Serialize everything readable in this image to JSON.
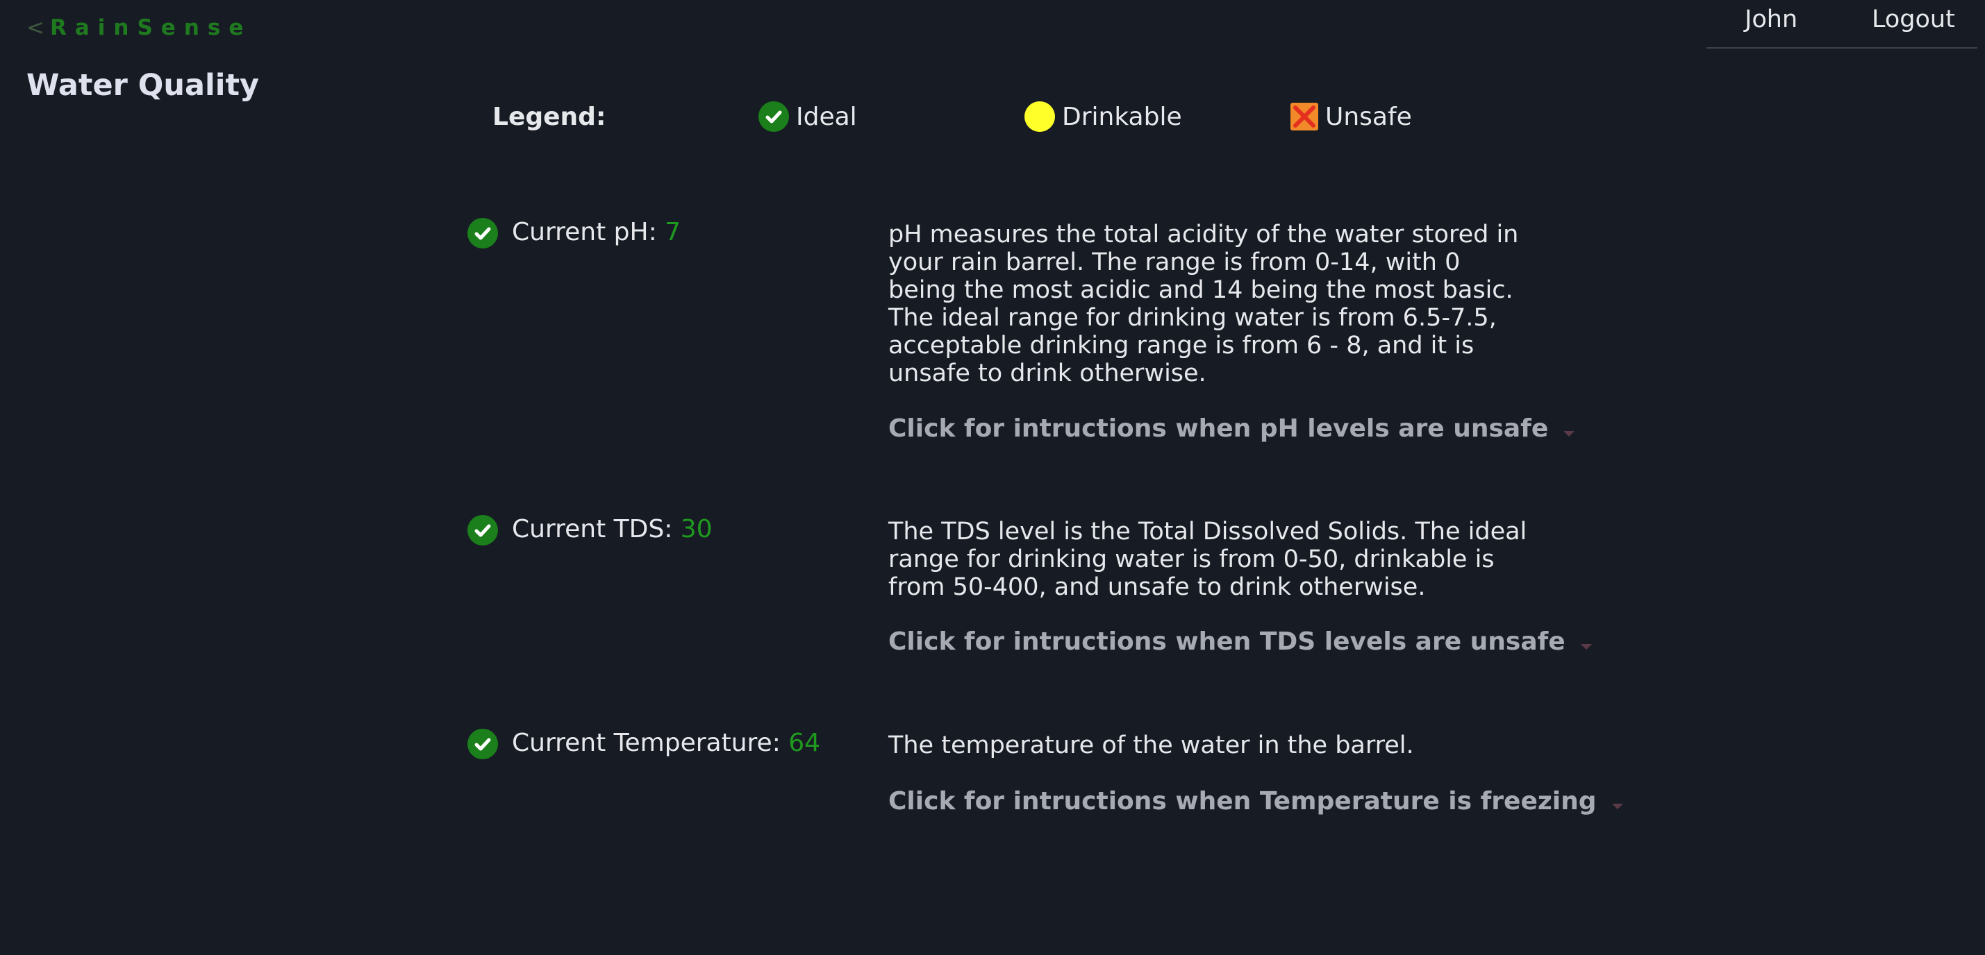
{
  "brand": {
    "caret": "<",
    "name": "RainSense"
  },
  "page_title": "Water Quality",
  "nav": {
    "user": "John",
    "logout": "Logout"
  },
  "legend": {
    "label": "Legend:",
    "items": [
      {
        "label": "Ideal",
        "icon": "green-check-icon",
        "color": "#1b7f1b"
      },
      {
        "label": "Drinkable",
        "icon": "yellow-circle-icon",
        "color": "#ffff29"
      },
      {
        "label": "Unsafe",
        "icon": "red-x-icon",
        "color": "#f28a2a"
      }
    ]
  },
  "metrics": [
    {
      "label": "Current pH: ",
      "value": "7",
      "status": "ideal",
      "description": "pH measures the total acidity of the water stored in your rain barrel. The range is from 0-14, with 0 being the most acidic and 14 being the most basic. The ideal range for drinking water is from 6.5-7.5, acceptable drinking range is from 6 - 8, and it is unsafe to drink otherwise.",
      "instructions_toggle": "Click for intructions when pH levels are unsafe"
    },
    {
      "label": "Current TDS: ",
      "value": "30",
      "status": "ideal",
      "description": "The TDS level is the Total Dissolved Solids. The ideal range for drinking water is from 0-50, drinkable is from 50-400, and unsafe to drink otherwise.",
      "instructions_toggle": "Click for intructions when TDS levels are unsafe"
    },
    {
      "label": "Current Temperature: ",
      "value": "64",
      "status": "ideal",
      "description": "The temperature of the water in the barrel.",
      "instructions_toggle": "Click for intructions when Temperature is freezing"
    }
  ],
  "colors": {
    "background": "#171c24",
    "accent_green": "#1f9a1f",
    "warning_yellow": "#ffff29",
    "unsafe_red": "#e53020"
  }
}
